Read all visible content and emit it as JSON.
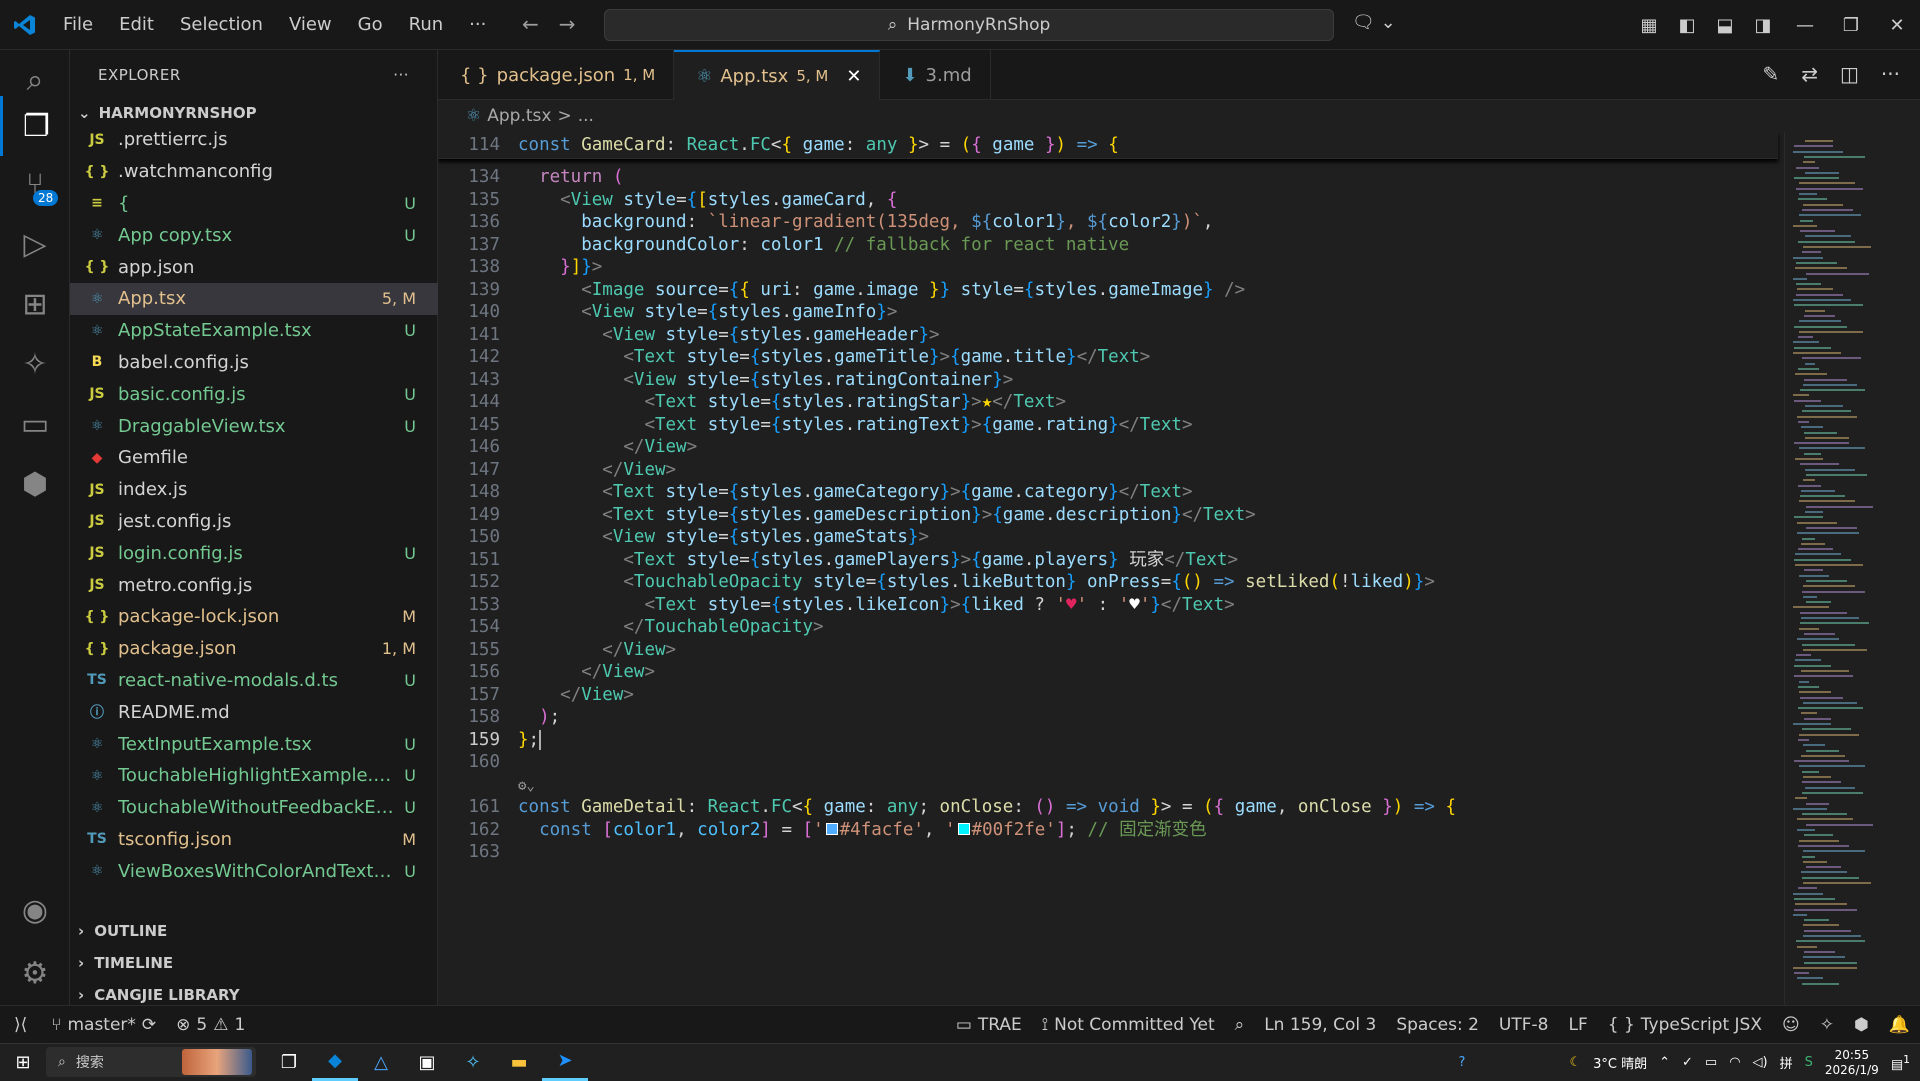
{
  "menu": {
    "file": "File",
    "edit": "Edit",
    "selection": "Selection",
    "view": "View",
    "go": "Go",
    "run": "Run",
    "more": "···"
  },
  "search": {
    "text": "HarmonyRnShop"
  },
  "sidebar": {
    "title": "EXPLORER",
    "more": "···",
    "project": "HARMONYRNSHOP",
    "files": [
      {
        "icon": "JS",
        "name": ".prettierrc.js",
        "status": "",
        "color": "plain"
      },
      {
        "icon": "{ }",
        "name": ".watchmanconfig",
        "status": "",
        "color": "plain"
      },
      {
        "icon": "≡",
        "name": "{",
        "status": "U",
        "color": "green"
      },
      {
        "icon": "⚛",
        "name": "App copy.tsx",
        "status": "U",
        "color": "green"
      },
      {
        "icon": "{ }",
        "name": "app.json",
        "status": "",
        "color": "plain"
      },
      {
        "icon": "⚛",
        "name": "App.tsx",
        "status": "5, M",
        "color": "orange"
      },
      {
        "icon": "⚛",
        "name": "AppStateExample.tsx",
        "status": "U",
        "color": "green"
      },
      {
        "icon": "B",
        "name": "babel.config.js",
        "status": "",
        "color": "plain"
      },
      {
        "icon": "JS",
        "name": "basic.config.js",
        "status": "U",
        "color": "green"
      },
      {
        "icon": "⚛",
        "name": "DraggableView.tsx",
        "status": "U",
        "color": "green"
      },
      {
        "icon": "◆",
        "name": "Gemfile",
        "status": "",
        "color": "plain"
      },
      {
        "icon": "JS",
        "name": "index.js",
        "status": "",
        "color": "plain"
      },
      {
        "icon": "JS",
        "name": "jest.config.js",
        "status": "",
        "color": "plain"
      },
      {
        "icon": "JS",
        "name": "login.config.js",
        "status": "U",
        "color": "green"
      },
      {
        "icon": "JS",
        "name": "metro.config.js",
        "status": "",
        "color": "plain"
      },
      {
        "icon": "{ }",
        "name": "package-lock.json",
        "status": "M",
        "color": "orange"
      },
      {
        "icon": "{ }",
        "name": "package.json",
        "status": "1, M",
        "color": "orange"
      },
      {
        "icon": "TS",
        "name": "react-native-modals.d.ts",
        "status": "U",
        "color": "green"
      },
      {
        "icon": "ⓘ",
        "name": "README.md",
        "status": "",
        "color": "plain"
      },
      {
        "icon": "⚛",
        "name": "TextInputExample.tsx",
        "status": "U",
        "color": "green"
      },
      {
        "icon": "⚛",
        "name": "TouchableHighlightExample.tsx",
        "status": "U",
        "color": "green"
      },
      {
        "icon": "⚛",
        "name": "TouchableWithoutFeedbackExa...",
        "status": "U",
        "color": "green"
      },
      {
        "icon": "TS",
        "name": "tsconfig.json",
        "status": "M",
        "color": "orange"
      },
      {
        "icon": "⚛",
        "name": "ViewBoxesWithColorAndText.tsx",
        "status": "U",
        "color": "green"
      }
    ],
    "sections": [
      "OUTLINE",
      "TIMELINE",
      "CANGJIE LIBRARY"
    ]
  },
  "scm_badge": "28",
  "tabs": [
    {
      "icon": "{ }",
      "label": "package.json",
      "status": "1, M"
    },
    {
      "icon": "⚛",
      "label": "App.tsx",
      "status": "5, M"
    },
    {
      "icon": "⬇",
      "label": "3.md",
      "status": ""
    }
  ],
  "breadcrumb": {
    "file": "App.tsx",
    "sep": ">",
    "rest": "..."
  },
  "editor": {
    "lines": [
      {
        "n": "114",
        "sticky": true,
        "html": "<span class='kb'>const</span> <span class='fn'>GameCard</span><span class='plain'>: </span><span class='ty'>React</span><span class='plain'>.</span><span class='ty'>FC</span><span class='plain'>&lt;</span><span class='br1'>{</span> <span class='vr'>game</span><span class='plain'>: </span><span class='ty'>any</span> <span class='br1'>}</span><span class='plain'>&gt; = </span><span class='br1'>(</span><span class='br2'>{</span> <span class='vr'>game</span> <span class='br2'>}</span><span class='br1'>)</span> <span class='kb'>=&gt;</span> <span class='br1'>{</span>"
      },
      {
        "n": "134",
        "html": "  <span class='kw'>return</span> <span class='br2'>(</span>"
      },
      {
        "n": "135",
        "html": "    <span class='pun'>&lt;</span><span class='tag'>View</span> <span class='vr'>style</span><span class='plain'>=</span><span class='br3'>{</span><span class='br1'>[</span><span class='vr'>styles</span><span class='plain'>.</span><span class='vr'>gameCard</span><span class='plain'>, </span><span class='br2'>{</span>"
      },
      {
        "n": "136",
        "html": "      <span class='vr'>background</span><span class='plain'>: </span><span class='str'>`linear-gradient(135deg, </span><span class='kb'>${</span><span class='vr'>color1</span><span class='kb'>}</span><span class='str'>, </span><span class='kb'>${</span><span class='vr'>color2</span><span class='kb'>}</span><span class='str'>)`</span><span class='plain'>,</span>"
      },
      {
        "n": "137",
        "html": "      <span class='vr'>backgroundColor</span><span class='plain'>: </span><span class='vr'>color1</span> <span class='cm'>// fallback for react native</span>"
      },
      {
        "n": "138",
        "html": "    <span class='br2'>}</span><span class='br1'>]</span><span class='br3'>}</span><span class='pun'>&gt;</span>"
      },
      {
        "n": "139",
        "html": "      <span class='pun'>&lt;</span><span class='tag'>Image</span> <span class='vr'>source</span><span class='plain'>=</span><span class='br3'>{</span><span class='br1'>{</span> <span class='vr'>uri</span><span class='plain'>: </span><span class='vr'>game</span><span class='plain'>.</span><span class='vr'>image</span> <span class='br1'>}</span><span class='br3'>}</span> <span class='vr'>style</span><span class='plain'>=</span><span class='br3'>{</span><span class='vr'>styles</span><span class='plain'>.</span><span class='vr'>gameImage</span><span class='br3'>}</span> <span class='pun'>/&gt;</span>"
      },
      {
        "n": "140",
        "html": "      <span class='pun'>&lt;</span><span class='tag'>View</span> <span class='vr'>style</span><span class='plain'>=</span><span class='br3'>{</span><span class='vr'>styles</span><span class='plain'>.</span><span class='vr'>gameInfo</span><span class='br3'>}</span><span class='pun'>&gt;</span>"
      },
      {
        "n": "141",
        "html": "        <span class='pun'>&lt;</span><span class='tag'>View</span> <span class='vr'>style</span><span class='plain'>=</span><span class='br3'>{</span><span class='vr'>styles</span><span class='plain'>.</span><span class='vr'>gameHeader</span><span class='br3'>}</span><span class='pun'>&gt;</span>"
      },
      {
        "n": "142",
        "html": "          <span class='pun'>&lt;</span><span class='tag'>Text</span> <span class='vr'>style</span><span class='plain'>=</span><span class='br3'>{</span><span class='vr'>styles</span><span class='plain'>.</span><span class='vr'>gameTitle</span><span class='br3'>}</span><span class='pun'>&gt;</span><span class='br3'>{</span><span class='vr'>game</span><span class='plain'>.</span><span class='vr'>title</span><span class='br3'>}</span><span class='pun'>&lt;/</span><span class='tag'>Text</span><span class='pun'>&gt;</span>"
      },
      {
        "n": "143",
        "html": "          <span class='pun'>&lt;</span><span class='tag'>View</span> <span class='vr'>style</span><span class='plain'>=</span><span class='br3'>{</span><span class='vr'>styles</span><span class='plain'>.</span><span class='vr'>ratingContainer</span><span class='br3'>}</span><span class='pun'>&gt;</span>"
      },
      {
        "n": "144",
        "html": "            <span class='pun'>&lt;</span><span class='tag'>Text</span> <span class='vr'>style</span><span class='plain'>=</span><span class='br3'>{</span><span class='vr'>styles</span><span class='plain'>.</span><span class='vr'>ratingStar</span><span class='br3'>}</span><span class='pun'>&gt;</span><span class='br1'>★</span><span class='pun'>&lt;/</span><span class='tag'>Text</span><span class='pun'>&gt;</span>"
      },
      {
        "n": "145",
        "html": "            <span class='pun'>&lt;</span><span class='tag'>Text</span> <span class='vr'>style</span><span class='plain'>=</span><span class='br3'>{</span><span class='vr'>styles</span><span class='plain'>.</span><span class='vr'>ratingText</span><span class='br3'>}</span><span class='pun'>&gt;</span><span class='br3'>{</span><span class='vr'>game</span><span class='plain'>.</span><span class='vr'>rating</span><span class='br3'>}</span><span class='pun'>&lt;/</span><span class='tag'>Text</span><span class='pun'>&gt;</span>"
      },
      {
        "n": "146",
        "html": "          <span class='pun'>&lt;/</span><span class='tag'>View</span><span class='pun'>&gt;</span>"
      },
      {
        "n": "147",
        "html": "        <span class='pun'>&lt;/</span><span class='tag'>View</span><span class='pun'>&gt;</span>"
      },
      {
        "n": "148",
        "html": "        <span class='pun'>&lt;</span><span class='tag'>Text</span> <span class='vr'>style</span><span class='plain'>=</span><span class='br3'>{</span><span class='vr'>styles</span><span class='plain'>.</span><span class='vr'>gameCategory</span><span class='br3'>}</span><span class='pun'>&gt;</span><span class='br3'>{</span><span class='vr'>game</span><span class='plain'>.</span><span class='vr'>category</span><span class='br3'>}</span><span class='pun'>&lt;/</span><span class='tag'>Text</span><span class='pun'>&gt;</span>"
      },
      {
        "n": "149",
        "html": "        <span class='pun'>&lt;</span><span class='tag'>Text</span> <span class='vr'>style</span><span class='plain'>=</span><span class='br3'>{</span><span class='vr'>styles</span><span class='plain'>.</span><span class='vr'>gameDescription</span><span class='br3'>}</span><span class='pun'>&gt;</span><span class='br3'>{</span><span class='vr'>game</span><span class='plain'>.</span><span class='vr'>description</span><span class='br3'>}</span><span class='pun'>&lt;/</span><span class='tag'>Text</span><span class='pun'>&gt;</span>"
      },
      {
        "n": "150",
        "html": "        <span class='pun'>&lt;</span><span class='tag'>View</span> <span class='vr'>style</span><span class='plain'>=</span><span class='br3'>{</span><span class='vr'>styles</span><span class='plain'>.</span><span class='vr'>gameStats</span><span class='br3'>}</span><span class='pun'>&gt;</span>"
      },
      {
        "n": "151",
        "html": "          <span class='pun'>&lt;</span><span class='tag'>Text</span> <span class='vr'>style</span><span class='plain'>=</span><span class='br3'>{</span><span class='vr'>styles</span><span class='plain'>.</span><span class='vr'>gamePlayers</span><span class='br3'>}</span><span class='pun'>&gt;</span><span class='br3'>{</span><span class='vr'>game</span><span class='plain'>.</span><span class='vr'>players</span><span class='br3'>}</span><span class='plain'> 玩家</span><span class='pun'>&lt;/</span><span class='tag'>Text</span><span class='pun'>&gt;</span>"
      },
      {
        "n": "152",
        "html": "          <span class='pun'>&lt;</span><span class='tag'>TouchableOpacity</span> <span class='vr'>style</span><span class='plain'>=</span><span class='br3'>{</span><span class='vr'>styles</span><span class='plain'>.</span><span class='vr'>likeButton</span><span class='br3'>}</span> <span class='vr'>onPress</span><span class='plain'>=</span><span class='br3'>{</span><span class='br1'>()</span> <span class='kb'>=&gt;</span> <span class='fn'>setLiked</span><span class='br1'>(</span><span class='plain'>!</span><span class='vr'>liked</span><span class='br1'>)</span><span class='br3'>}</span><span class='pun'>&gt;</span>"
      },
      {
        "n": "153",
        "html": "            <span class='pun'>&lt;</span><span class='tag'>Text</span> <span class='vr'>style</span><span class='plain'>=</span><span class='br3'>{</span><span class='vr'>styles</span><span class='plain'>.</span><span class='vr'>likeIcon</span><span class='br3'>}</span><span class='pun'>&gt;</span><span class='br3'>{</span><span class='vr'>liked</span><span class='plain'> ? </span><span class='str'>'</span><span style='color:#e0245e'>♥</span><span class='str'>'</span><span class='plain'> : </span><span class='str'>'</span><span style='color:#ffffff'>♥</span><span class='str'>'</span><span class='br3'>}</span><span class='pun'>&lt;/</span><span class='tag'>Text</span><span class='pun'>&gt;</span>"
      },
      {
        "n": "154",
        "html": "          <span class='pun'>&lt;/</span><span class='tag'>TouchableOpacity</span><span class='pun'>&gt;</span>"
      },
      {
        "n": "155",
        "html": "        <span class='pun'>&lt;/</span><span class='tag'>View</span><span class='pun'>&gt;</span>"
      },
      {
        "n": "156",
        "html": "      <span class='pun'>&lt;/</span><span class='tag'>View</span><span class='pun'>&gt;</span>"
      },
      {
        "n": "157",
        "html": "    <span class='pun'>&lt;/</span><span class='tag'>View</span><span class='pun'>&gt;</span>"
      },
      {
        "n": "158",
        "html": "  <span class='br2'>)</span><span class='plain'>;</span>"
      },
      {
        "n": "159",
        "html": "<span class='br1'>}</span><span class='plain'>;</span>",
        "current": true
      },
      {
        "n": "160",
        "html": ""
      },
      {
        "n": "",
        "html": "",
        "lens": true
      },
      {
        "n": "161",
        "html": "<span class='kb'>const</span> <span class='fn'>GameDetail</span><span class='plain'>: </span><span class='ty'>React</span><span class='plain'>.</span><span class='ty'>FC</span><span class='plain'>&lt;</span><span class='br1'>{</span> <span class='vr'>game</span><span class='plain'>: </span><span class='ty'>any</span><span class='plain'>; </span><span class='fn'>onClose</span><span class='plain'>: </span><span class='br2'>()</span> <span class='kb'>=&gt;</span> <span class='kb'>void</span> <span class='br1'>}</span><span class='plain'>&gt; = </span><span class='br1'>(</span><span class='br2'>{</span> <span class='vr'>game</span><span class='plain'>, </span><span class='fn'>onClose</span> <span class='br2'>}</span><span class='br1'>)</span> <span class='kb'>=&gt;</span> <span class='br1'>{</span>"
      },
      {
        "n": "162",
        "html": "  <span class='kb'>const</span> <span class='br2'>[</span><span class='cn'>color1</span><span class='plain'>, </span><span class='cn'>color2</span><span class='br2'>]</span><span class='plain'> = </span><span class='br2'>[</span><span class='str'>'</span><span style='display:inline-block;width:12px;height:12px;background:#4facfe;border:1px solid #fff;margin:0 2px'></span><span class='str'>#4facfe'</span><span class='plain'>, </span><span class='str'>'</span><span style='display:inline-block;width:12px;height:12px;background:#00f2fe;border:1px solid #fff;margin:0 2px'></span><span class='str'>#00f2fe'</span><span class='br2'>]</span><span class='plain'>; </span><span class='cm'>// 固定渐变色</span>"
      },
      {
        "n": "163",
        "html": ""
      }
    ]
  },
  "status": {
    "branch": "master*",
    "errors": "5",
    "warnings": "1",
    "trae": "TRAE",
    "blame": "Not Committed Yet",
    "position": "Ln 159, Col 3",
    "spaces": "Spaces: 2",
    "encoding": "UTF-8",
    "eol": "LF",
    "language": "TypeScript JSX"
  },
  "taskbar": {
    "search": "搜索",
    "weather": "3°C 晴朗",
    "time": "20:55",
    "date": "2026/1/9",
    "notif": "1"
  }
}
